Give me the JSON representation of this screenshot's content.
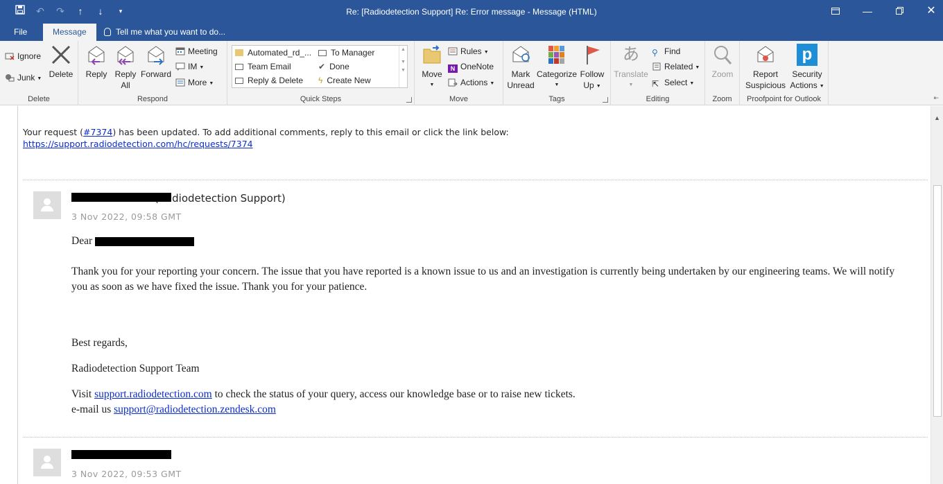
{
  "window": {
    "title": "Re: [Radiodetection Support] Re: Error message - Message (HTML)"
  },
  "tabs": {
    "file": "File",
    "message": "Message",
    "tell_me": "Tell me what you want to do..."
  },
  "ribbon": {
    "delete_group": {
      "label": "Delete",
      "ignore": "Ignore",
      "junk": "Junk",
      "delete": "Delete"
    },
    "respond_group": {
      "label": "Respond",
      "reply": "Reply",
      "reply_all_1": "Reply",
      "reply_all_2": "All",
      "forward": "Forward",
      "meeting": "Meeting",
      "im": "IM",
      "more": "More"
    },
    "quick_steps": {
      "label": "Quick Steps",
      "items": [
        "Automated_rd_...",
        "Team Email",
        "Reply & Delete",
        "To Manager",
        "Done",
        "Create New"
      ]
    },
    "move_group": {
      "label": "Move",
      "move": "Move",
      "rules": "Rules",
      "onenote": "OneNote",
      "actions": "Actions"
    },
    "tags_group": {
      "label": "Tags",
      "mark_unread_1": "Mark",
      "mark_unread_2": "Unread",
      "categorize": "Categorize",
      "follow_up_1": "Follow",
      "follow_up_2": "Up"
    },
    "editing_group": {
      "label": "Editing",
      "translate": "Translate",
      "find": "Find",
      "related": "Related",
      "select": "Select"
    },
    "zoom_group": {
      "label": "Zoom",
      "zoom": "Zoom"
    },
    "proofpoint_group": {
      "label": "Proofpoint for Outlook",
      "report_1": "Report",
      "report_2": "Suspicious",
      "security_1": "Security",
      "security_2": "Actions"
    }
  },
  "message": {
    "update_prefix": "Your request (",
    "request_link": "#7374",
    "update_suffix": ") has been updated. To add additional comments, reply to this email or click the link below:",
    "request_url": "https://support.radiodetection.com/hc/requests/7374",
    "entry1": {
      "sender_suffix": "(Radiodetection Support)",
      "date": "3 Nov 2022, 09:58 GMT",
      "greeting": "Dear",
      "para1_line1": "Thank you for your reporting your concern. The issue that you have reported is a known issue to us and an investigation is currently being undertaken by our engineering teams. We will notify",
      "para1_line2": "you as soon as we have fixed the issue. Thank you for your patience.",
      "regards": "Best regards,",
      "team": "Radiodetection Support Team",
      "visit_prefix": "Visit",
      "visit_link": "support.radiodetection.com",
      "visit_suffix": "to check the status of your query, access our knowledge base or to raise new tickets.",
      "email_prefix": "e-mail us",
      "email_link": "support@radiodetection.zendesk.com"
    },
    "entry2": {
      "date": "3 Nov 2022, 09:53 GMT"
    }
  },
  "colors": {
    "titlebar": "#2b579a",
    "ribbon_bg": "#f3f3f3",
    "link": "#0b2cd0",
    "proofpoint": "#1e8fd6",
    "flag": "#e0584a"
  }
}
